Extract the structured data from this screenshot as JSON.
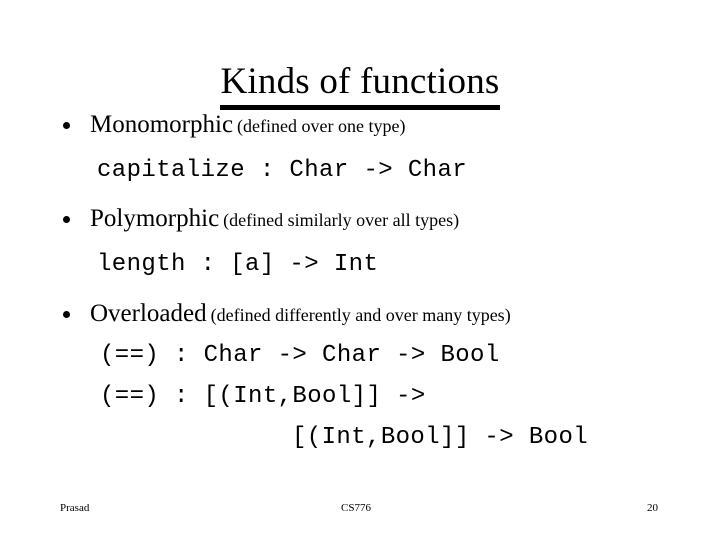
{
  "slide": {
    "title": "Kinds of functions",
    "bullets": [
      {
        "term": "Monomorphic",
        "note": "(defined over one type)",
        "code": [
          "capitalize : Char -> Char"
        ]
      },
      {
        "term": "Polymorphic",
        "note": "(defined similarly over all types)",
        "code": [
          "length : [a] -> Int"
        ]
      },
      {
        "term": "Overloaded",
        "note": "(defined differently and over many types)",
        "code": [
          "(==) : Char -> Char -> Bool",
          "(==) : [(Int,Bool]] ->",
          "[(Int,Bool]] -> Bool"
        ]
      }
    ],
    "footer": {
      "author": "Prasad",
      "course": "CS776",
      "page_number": "20"
    },
    "colors": {
      "background": "#ffffff",
      "text": "#000000"
    }
  }
}
